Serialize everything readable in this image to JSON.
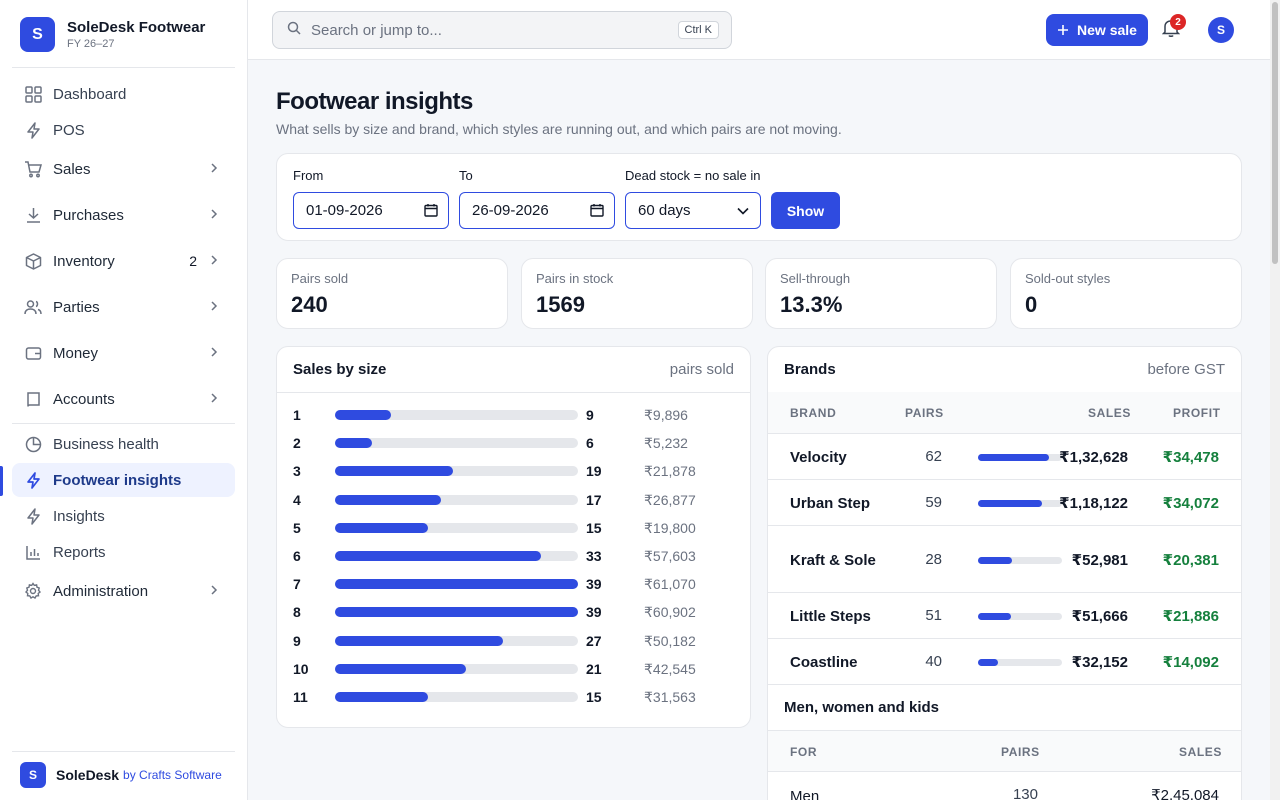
{
  "app": {
    "name": "SoleDesk Footwear",
    "fy": "FY 26–27",
    "logo_letter": "S"
  },
  "sidebar": {
    "items": [
      {
        "label": "Dashboard",
        "icon": "grid-icon"
      },
      {
        "label": "POS",
        "icon": "bolt-icon"
      },
      {
        "label": "Sales",
        "icon": "cart-icon"
      },
      {
        "label": "Purchases",
        "icon": "download-icon"
      },
      {
        "label": "Inventory",
        "icon": "box-icon",
        "count": "2"
      },
      {
        "label": "Parties",
        "icon": "users-icon"
      },
      {
        "label": "Money",
        "icon": "wallet-icon"
      },
      {
        "label": "Accounts",
        "icon": "book-icon"
      },
      {
        "label": "Business health",
        "icon": "pie-icon"
      },
      {
        "label": "Footwear insights",
        "icon": "bolt-icon"
      },
      {
        "label": "Insights",
        "icon": "bolt-icon"
      },
      {
        "label": "Reports",
        "icon": "bar-chart-icon"
      },
      {
        "label": "Administration",
        "icon": "gear-icon"
      }
    ],
    "footer": {
      "name": "SoleDesk",
      "by": "by Crafts Software",
      "logo_letter": "S"
    }
  },
  "topbar": {
    "search_placeholder": "Search or jump to...",
    "shortcut": "Ctrl K",
    "new_sale": "New sale",
    "notifications": "2",
    "avatar": "S"
  },
  "page": {
    "title": "Footwear insights",
    "subtitle": "What sells by size and brand, which styles are running out, and which pairs are not moving."
  },
  "filters": {
    "from_label": "From",
    "from_value": "01-09-2026",
    "to_label": "To",
    "to_value": "26-09-2026",
    "dead_label": "Dead stock = no sale in",
    "dead_value": "60 days",
    "show": "Show"
  },
  "stats": [
    {
      "label": "Pairs sold",
      "value": "240"
    },
    {
      "label": "Pairs in stock",
      "value": "1569"
    },
    {
      "label": "Sell-through",
      "value": "13.3%"
    },
    {
      "label": "Sold-out styles",
      "value": "0"
    }
  ],
  "sizes": {
    "title": "Sales by size",
    "note": "pairs sold",
    "max_pairs": 39,
    "rows": [
      {
        "size": "1",
        "pairs": 9,
        "amount": "₹9,896"
      },
      {
        "size": "2",
        "pairs": 6,
        "amount": "₹5,232"
      },
      {
        "size": "3",
        "pairs": 19,
        "amount": "₹21,878"
      },
      {
        "size": "4",
        "pairs": 17,
        "amount": "₹26,877"
      },
      {
        "size": "5",
        "pairs": 15,
        "amount": "₹19,800"
      },
      {
        "size": "6",
        "pairs": 33,
        "amount": "₹57,603"
      },
      {
        "size": "7",
        "pairs": 39,
        "amount": "₹61,070"
      },
      {
        "size": "8",
        "pairs": 39,
        "amount": "₹60,902"
      },
      {
        "size": "9",
        "pairs": 27,
        "amount": "₹50,182"
      },
      {
        "size": "10",
        "pairs": 21,
        "amount": "₹42,545"
      },
      {
        "size": "11",
        "pairs": 15,
        "amount": "₹31,563"
      }
    ]
  },
  "brands": {
    "title": "Brands",
    "note": "before GST",
    "headers": {
      "brand": "BRAND",
      "pairs": "PAIRS",
      "sales": "SALES",
      "profit": "PROFIT"
    },
    "rows": [
      {
        "name": "Velocity",
        "pairs": "62",
        "sales": "₹1,32,628",
        "profit": "₹34,478",
        "share": 0.84
      },
      {
        "name": "Urban Step",
        "pairs": "59",
        "sales": "₹1,18,122",
        "profit": "₹34,072",
        "share": 0.76
      },
      {
        "name": "Kraft & Sole",
        "pairs": "28",
        "sales": "₹52,981",
        "profit": "₹20,381",
        "share": 0.4
      },
      {
        "name": "Little Steps",
        "pairs": "51",
        "sales": "₹51,666",
        "profit": "₹21,886",
        "share": 0.39
      },
      {
        "name": "Coastline",
        "pairs": "40",
        "sales": "₹32,152",
        "profit": "₹14,092",
        "share": 0.24
      }
    ]
  },
  "segments": {
    "title": "Men, women and kids",
    "headers": {
      "for": "FOR",
      "pairs": "PAIRS",
      "sales": "SALES"
    },
    "rows": [
      {
        "for": "Men",
        "pairs": "130",
        "sales": "₹2,45,084"
      }
    ]
  }
}
